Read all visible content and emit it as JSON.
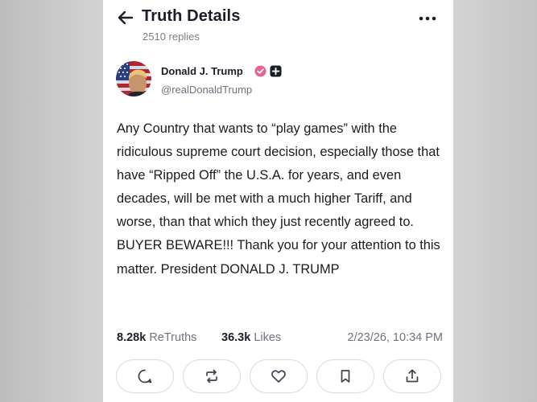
{
  "header": {
    "title": "Truth Details",
    "replies": "2510 replies"
  },
  "author": {
    "name": "Donald J. Trump",
    "handle": "@realDonaldTrump"
  },
  "post": {
    "text": "Any Country that wants to “play games” with the ridiculous supreme court decision, especially those that have “Ripped Off” the U.S.A. for years, and even decades, will be met with a much higher Tariff, and worse, than that which they just recently agreed to. BUYER BEWARE!!! Thank you for your attention to this matter. President DONALD J. TRUMP"
  },
  "stats": {
    "retruths_count": "8.28k",
    "retruths_label": "ReTruths",
    "likes_count": "36.3k",
    "likes_label": "Likes",
    "timestamp": "2/23/26, 10:34 PM"
  },
  "colors": {
    "verified": "#e46495",
    "text": "#1b1d29",
    "muted": "#6f7380"
  },
  "icons": {
    "back": "arrow-left-icon",
    "more": "more-horizontal-icon",
    "reply": "reply-icon",
    "retruth": "retruth-icon",
    "like": "heart-icon",
    "bookmark": "bookmark-icon",
    "share": "share-icon"
  }
}
